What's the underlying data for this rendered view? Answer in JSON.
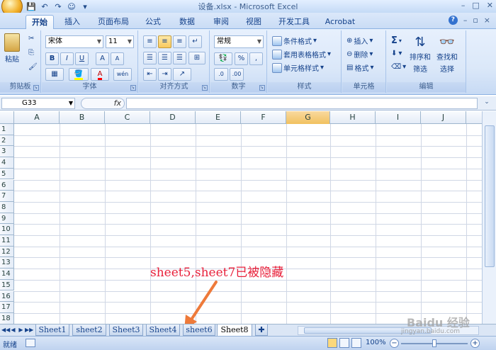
{
  "window": {
    "title": "设备.xlsx - Microsoft Excel",
    "controls": [
      "–",
      "□",
      "✕"
    ]
  },
  "tabs": [
    {
      "label": "开始",
      "active": true
    },
    {
      "label": "插入"
    },
    {
      "label": "页面布局"
    },
    {
      "label": "公式"
    },
    {
      "label": "数据"
    },
    {
      "label": "审阅"
    },
    {
      "label": "视图"
    },
    {
      "label": "开发工具"
    },
    {
      "label": "Acrobat"
    }
  ],
  "ribbon": {
    "clipboard": {
      "paste": "粘贴",
      "label": "剪贴板"
    },
    "font": {
      "name": "宋体",
      "size": "11",
      "label": "字体",
      "bold": "B",
      "italic": "I",
      "underline": "U",
      "grow": "A",
      "shrink": "A",
      "color": "A",
      "wen": "wén"
    },
    "alignment": {
      "label": "对齐方式"
    },
    "number": {
      "format": "常规",
      "percent": "%",
      "comma": ",",
      "label": "数字"
    },
    "styles": {
      "conditional": "条件格式",
      "table": "套用表格格式",
      "cell": "单元格样式",
      "label": "样式"
    },
    "cells": {
      "insert": "插入",
      "delete": "删除",
      "format": "格式",
      "label": "单元格"
    },
    "editing": {
      "sigma": "Σ",
      "sort_line1": "排序和",
      "sort_line2": "筛选",
      "find_line1": "查找和",
      "find_line2": "选择",
      "label": "编辑"
    }
  },
  "formula_bar": {
    "name_box": "G33",
    "fx": "fx",
    "value": ""
  },
  "grid": {
    "columns": [
      "A",
      "B",
      "C",
      "D",
      "E",
      "F",
      "G",
      "H",
      "I",
      "J"
    ],
    "selected_column": "G",
    "rows": [
      "1",
      "2",
      "3",
      "4",
      "5",
      "6",
      "7",
      "8",
      "9",
      "10",
      "11",
      "12",
      "13",
      "14",
      "15",
      "16",
      "17",
      "18"
    ]
  },
  "annotation": "sheet5,sheet7已被隐藏",
  "sheets": {
    "tabs": [
      "Sheet1",
      "sheet2",
      "Sheet3",
      "Sheet4",
      "sheet6",
      "Sheet8"
    ],
    "active": "Sheet8"
  },
  "status": {
    "ready": "就绪",
    "zoom": "100%",
    "minus": "−",
    "plus": "+"
  },
  "watermark": {
    "brand": "Baidu 经验",
    "url": "jingyan.baidu.com"
  }
}
